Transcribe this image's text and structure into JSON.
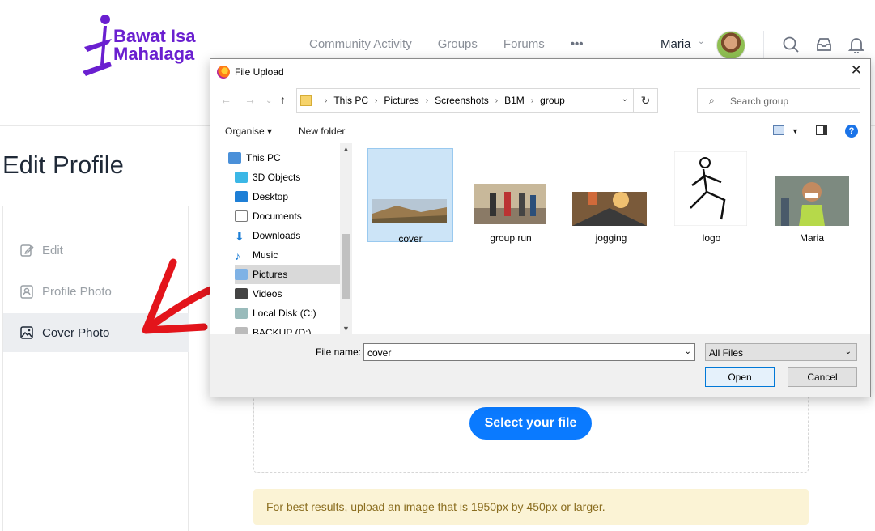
{
  "brand": {
    "line1": "Bawat Isa",
    "line2": "Mahalaga"
  },
  "nav": {
    "items": [
      "Community Activity",
      "Groups",
      "Forums"
    ],
    "more": "•••"
  },
  "user": {
    "name": "Maria"
  },
  "page": {
    "title": "Edit Profile"
  },
  "menu": {
    "items": [
      {
        "label": "Edit",
        "icon": "edit-icon"
      },
      {
        "label": "Profile Photo",
        "icon": "profile-photo-icon"
      },
      {
        "label": "Cover Photo",
        "icon": "image-icon"
      }
    ]
  },
  "upload": {
    "button": "Select your file",
    "notice": "For best results, upload an image that is 1950px by 450px or larger."
  },
  "dialog": {
    "title": "File Upload",
    "path": [
      "This PC",
      "Pictures",
      "Screenshots",
      "B1M",
      "group"
    ],
    "search_placeholder": "Search group",
    "organise": "Organise",
    "new_folder": "New folder",
    "tree": [
      "This PC",
      "3D Objects",
      "Desktop",
      "Documents",
      "Downloads",
      "Music",
      "Pictures",
      "Videos",
      "Local Disk (C:)",
      "BACKUP (D:)"
    ],
    "files": [
      "cover",
      "group run",
      "jogging",
      "logo",
      "Maria"
    ],
    "file_name_label": "File name:",
    "file_name_value": "cover",
    "file_type": "All Files",
    "open": "Open",
    "cancel": "Cancel"
  },
  "colors": {
    "brand": "#6a1fd0",
    "primary": "#0a7aff",
    "arrow": "#e3141b",
    "notice_bg": "#fbf3d5"
  }
}
